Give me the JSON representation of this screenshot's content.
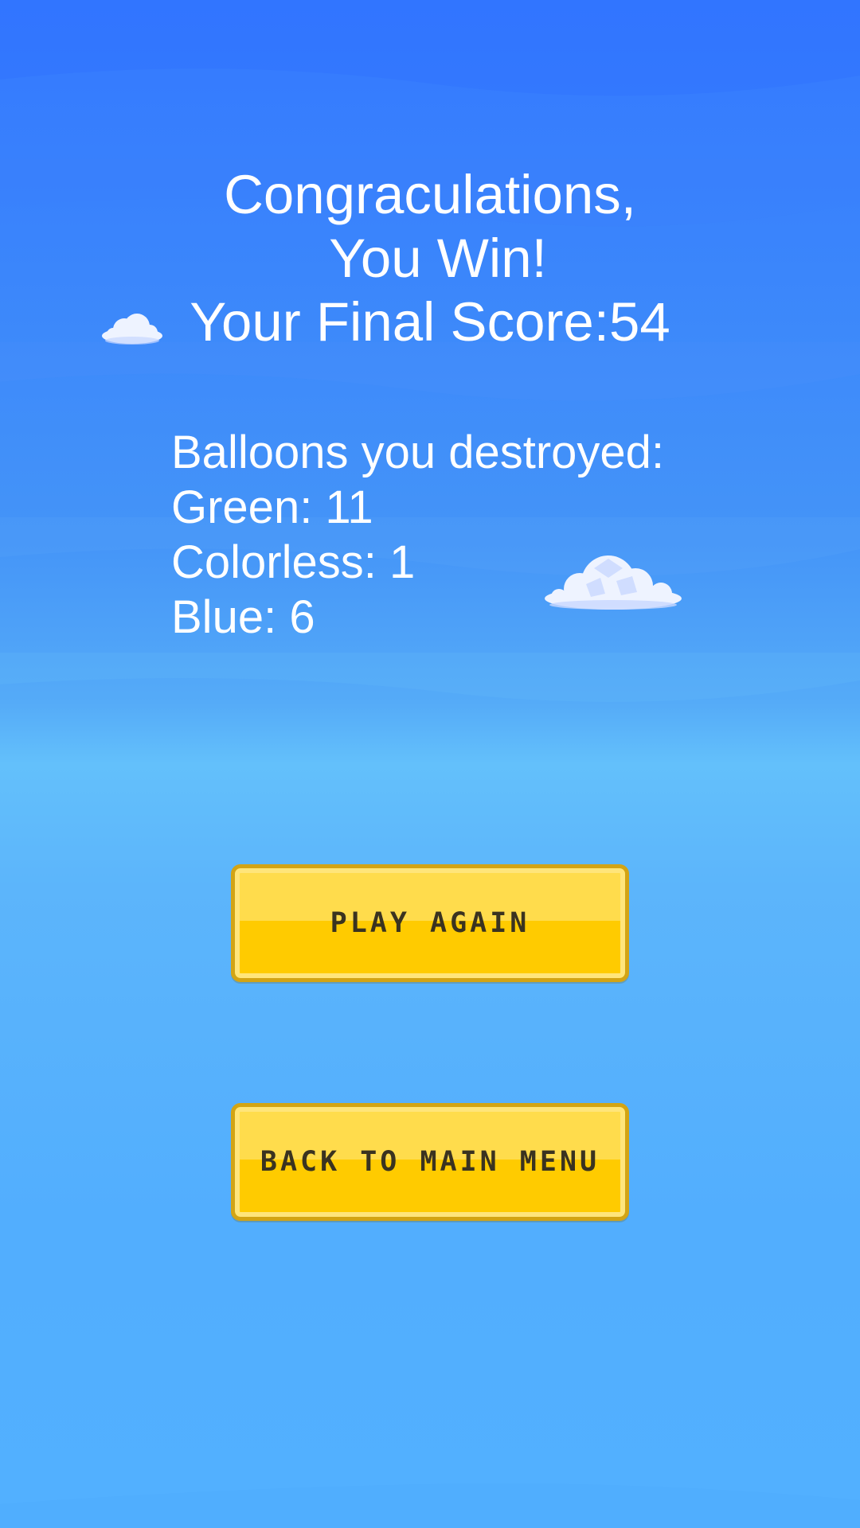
{
  "result": {
    "line1": "Congraculations,",
    "line2": "You Win!",
    "line3": "Your Final Score:54"
  },
  "stats": {
    "heading": "Balloons you destroyed:",
    "green": "Green: 11",
    "colorless": "Colorless: 1",
    "blue": "Blue: 6"
  },
  "buttons": {
    "play_again": "PLAY AGAIN",
    "main_menu": "BACK TO MAIN MENU"
  },
  "colors": {
    "sky_top": "#3478ff",
    "sky_bottom": "#52b0ff",
    "button_fill": "#ffcb00",
    "button_border": "#d3a414",
    "button_text": "#3a3320",
    "text": "#ffffff"
  },
  "icons": [
    "cloud-icon",
    "cloud-icon"
  ]
}
